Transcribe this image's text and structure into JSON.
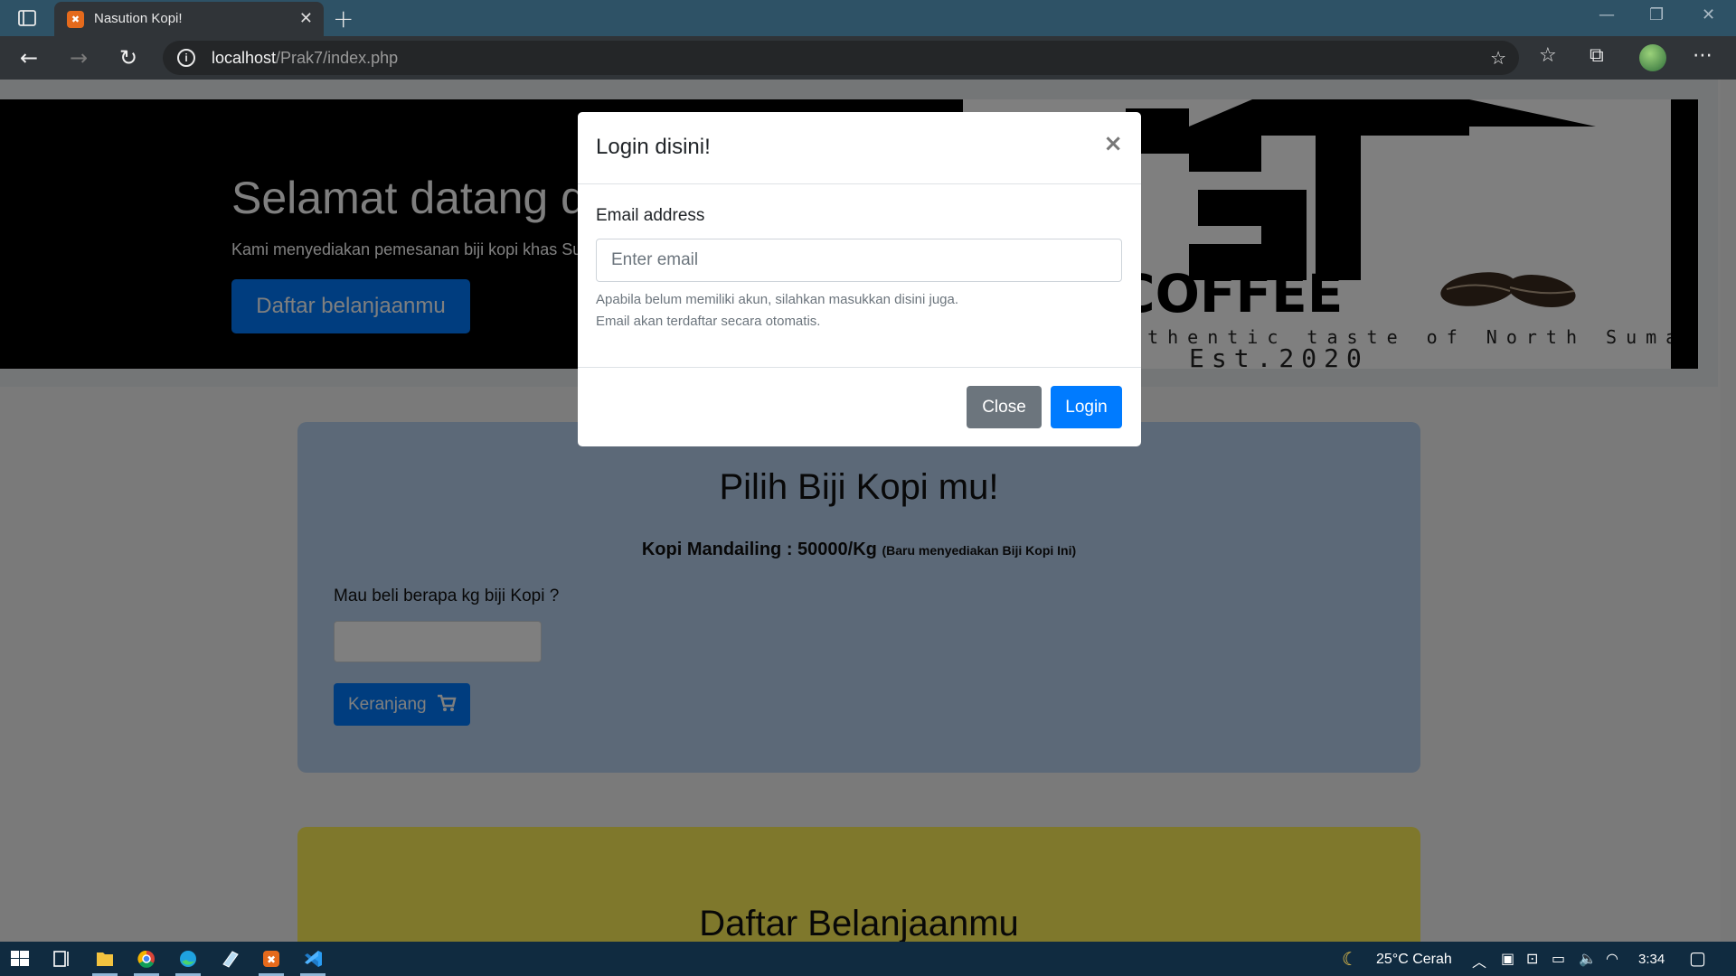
{
  "browser": {
    "tab_title": "Nasution Kopi!",
    "tab_favicon_text": "☒",
    "url_host": "localhost",
    "url_path": "/Prak7/index.php"
  },
  "hero": {
    "title": "Selamat datang di Nasution Kopi!",
    "subtitle": "Kami menyediakan pemesanan biji kopi khas Sumatera Utara",
    "button": "Daftar belanjaanmu",
    "logo_tagline": "Authentic taste of North Sumatera",
    "logo_est": "Est.2020",
    "logo_word": "COFFEE"
  },
  "order_card": {
    "title": "Pilih Biji Kopi mu!",
    "price_main": "Kopi Mandailing : 50000/Kg",
    "price_note": "(Baru menyediakan Biji Kopi Ini)",
    "qty_label": "Mau beli berapa kg biji Kopi ?",
    "qty_value": "",
    "cart_button": "Keranjang"
  },
  "cart_card": {
    "title": "Daftar Belanjaanmu"
  },
  "modal": {
    "title": "Login disini!",
    "close_x": "×",
    "email_label": "Email address",
    "email_placeholder": "Enter email",
    "help_line1": "Apabila belum memiliki akun, silahkan masukkan disini juga.",
    "help_line2": "Email akan terdaftar secara otomatis.",
    "close_button": "Close",
    "login_button": "Login"
  },
  "taskbar": {
    "weather": "25°C Cerah",
    "time": "3:34"
  },
  "colors": {
    "primary": "#007bff",
    "secondary": "#6c757d",
    "card_blue": "#b8d2f0",
    "card_yellow": "#fff159"
  }
}
